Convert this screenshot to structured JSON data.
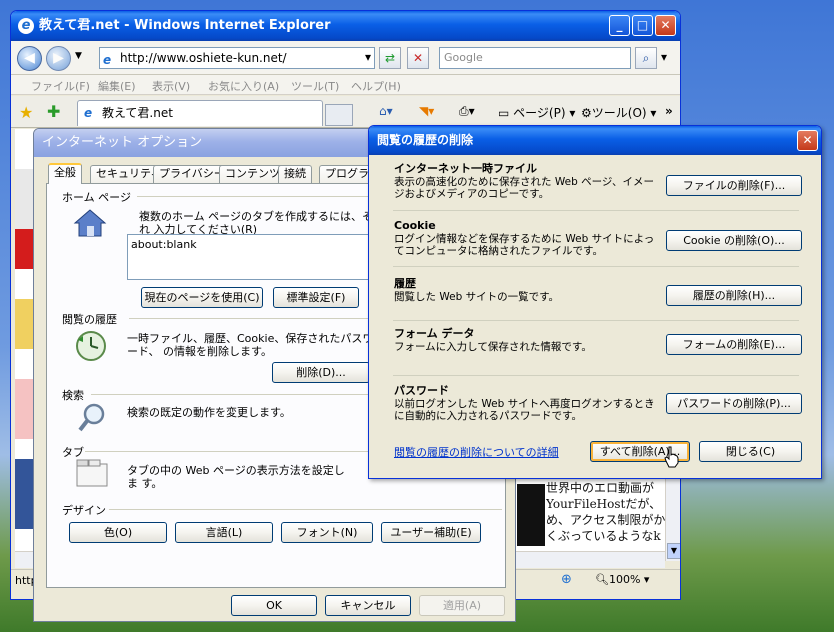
{
  "ie": {
    "title": "教えて君.net - Windows Internet Explorer",
    "address": "http://www.oshiete-kun.net/",
    "search_placeholder": "Google",
    "menu": [
      "ファイル(F)",
      "編集(E)",
      "表示(V)",
      "お気に入り(A)",
      "ツール(T)",
      "ヘルプ(H)"
    ],
    "tab_label": "教えて君.net",
    "commands": {
      "page": "ページ(P)",
      "tools": "ツール(O)"
    },
    "status_left": "http",
    "zoom": "100%",
    "page_text": [
      "世界中のエロ動画が",
      "YourFileHostだが、",
      "め、アクセス制限がか",
      "くぶっているようなk"
    ]
  },
  "options": {
    "title": "インターネット オプション",
    "tabs": [
      "全般",
      "セキュリティ",
      "プライバシー",
      "コンテンツ",
      "接続",
      "プログラム"
    ],
    "home": {
      "title": "ホーム ページ",
      "text": "複数のホーム ページのタブを作成するには、それぞれ 入力してください(R)",
      "url": "about:blank",
      "btn_current": "現在のページを使用(C)",
      "btn_default": "標準設定(F)"
    },
    "history": {
      "title": "閲覧の履歴",
      "text": "一時ファイル、履歴、Cookie、保存されたパスワード、 の情報を削除します。",
      "btn_delete": "削除(D)..."
    },
    "search": {
      "title": "検索",
      "text": "検索の既定の動作を変更します。"
    },
    "tabs_section": {
      "title": "タブ",
      "text": "タブの中の Web ページの表示方法を設定しま す。"
    },
    "design": {
      "title": "デザイン",
      "buttons": [
        "色(O)",
        "言語(L)",
        "フォント(N)",
        "ユーザー補助(E)"
      ]
    },
    "footer": {
      "ok": "OK",
      "cancel": "キャンセル",
      "apply": "適用(A)"
    }
  },
  "delete_history": {
    "title": "閲覧の履歴の削除",
    "sections": [
      {
        "heading": "インターネット一時ファイル",
        "desc": "表示の高速化のために保存された Web ページ、イメージおよびメディアのコピーです。",
        "button": "ファイルの削除(F)..."
      },
      {
        "heading": "Cookie",
        "desc": "ログイン情報などを保存するために Web サイトによってコンピュータに格納されたファイルです。",
        "button": "Cookie の削除(O)..."
      },
      {
        "heading": "履歴",
        "desc": "閲覧した Web サイトの一覧です。",
        "button": "履歴の削除(H)..."
      },
      {
        "heading": "フォーム データ",
        "desc": "フォームに入力して保存された情報です。",
        "button": "フォームの削除(E)..."
      },
      {
        "heading": "パスワード",
        "desc": "以前ログオンした Web サイトへ再度ログオンするときに自動的に入力されるパスワードです。",
        "button": "パスワードの削除(P)..."
      }
    ],
    "link": "閲覧の履歴の削除についての詳細",
    "btn_delete_all": "すべて削除(A)...",
    "btn_close": "閉じる(C)"
  }
}
